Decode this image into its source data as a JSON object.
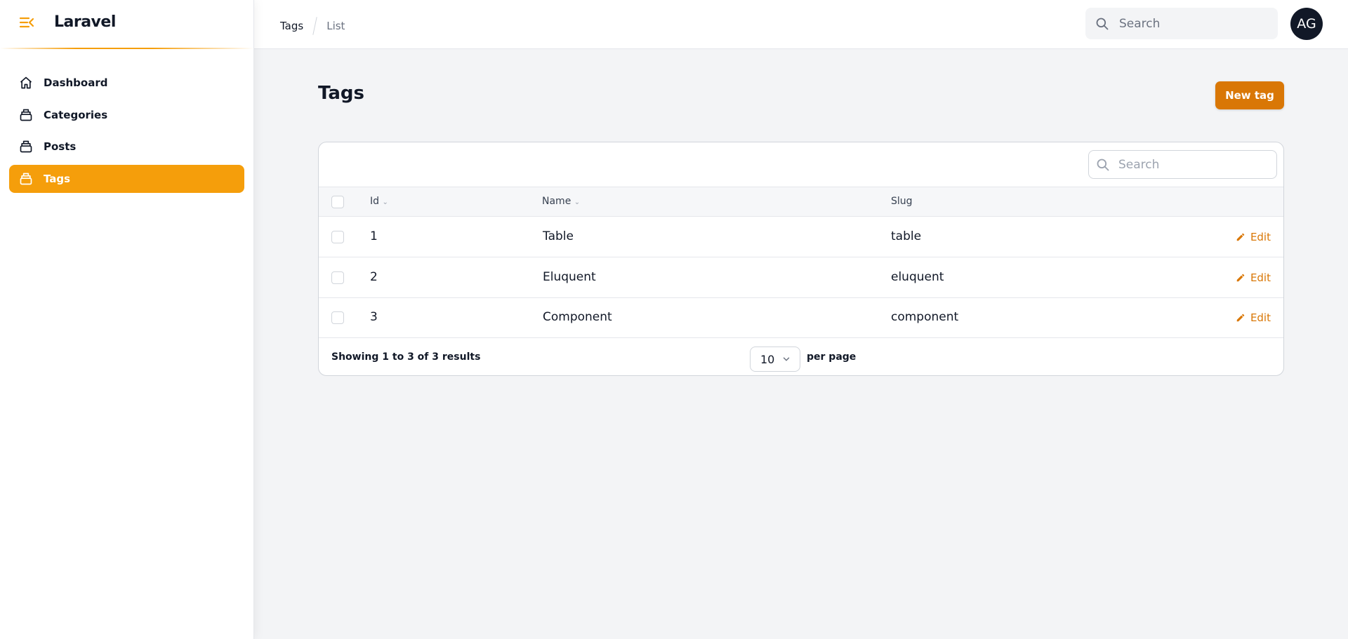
{
  "app": {
    "title": "Laravel",
    "accent": "#f59e0b",
    "button_color": "#d97706"
  },
  "sidebar": {
    "items": [
      {
        "label": "Dashboard",
        "icon": "home-icon",
        "active": false
      },
      {
        "label": "Categories",
        "icon": "stack-icon",
        "active": false
      },
      {
        "label": "Posts",
        "icon": "stack-icon",
        "active": false
      },
      {
        "label": "Tags",
        "icon": "stack-icon",
        "active": true
      }
    ]
  },
  "header": {
    "breadcrumbs": [
      "Tags",
      "List"
    ],
    "search_placeholder": "Search",
    "avatar_initials": "AG"
  },
  "page": {
    "title": "Tags",
    "new_button": "New tag"
  },
  "table": {
    "search_placeholder": "Search",
    "columns": [
      "Id",
      "Name",
      "Slug"
    ],
    "rows": [
      {
        "id": "1",
        "name": "Table",
        "slug": "table",
        "action": "Edit"
      },
      {
        "id": "2",
        "name": "Eluquent",
        "slug": "eluquent",
        "action": "Edit"
      },
      {
        "id": "3",
        "name": "Component",
        "slug": "component",
        "action": "Edit"
      }
    ],
    "summary": "Showing 1 to 3 of 3 results",
    "per_page_value": "10",
    "per_page_label": "per page"
  }
}
